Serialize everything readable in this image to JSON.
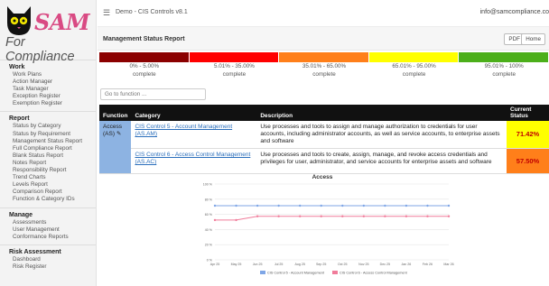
{
  "logo": {
    "sam": "SAM",
    "tagline": "For Compliance"
  },
  "topbar": {
    "menu_icon": "hamburger-icon",
    "breadcrumb": "Demo - CIS Controls v8.1",
    "user": "info@samcompliance.co"
  },
  "sidebar": {
    "sections": [
      {
        "heading": "Work",
        "items": [
          "Work Plans",
          "Action Manager",
          "Task Manager",
          "Exception Register",
          "Exemption Register"
        ]
      },
      {
        "heading": "Report",
        "items": [
          "Status by Category",
          "Status by Requirement",
          "Management Status Report",
          "Full Compliance Report",
          "Blank Status Report",
          "Notes Report",
          "Responsibility Report",
          "Trend Charts",
          "Levels Report",
          "Comparison Report",
          "Function & Category IDs"
        ]
      },
      {
        "heading": "Manage",
        "items": [
          "Assessments",
          "User Management",
          "Conformance Reports"
        ]
      },
      {
        "heading": "Risk Assessment",
        "items": [
          "Dashboard",
          "Risk Register"
        ]
      }
    ]
  },
  "report": {
    "title": "Management Status Report",
    "pdf_label": "PDF",
    "home_label": "Home"
  },
  "legend": [
    {
      "range": "0% - 5.00%",
      "label": "complete",
      "color": "#8b0000"
    },
    {
      "range": "5.01% - 35.00%",
      "label": "complete",
      "color": "#ff0000"
    },
    {
      "range": "35.01% - 65.00%",
      "label": "complete",
      "color": "#ff7f1a"
    },
    {
      "range": "65.01% - 95.00%",
      "label": "complete",
      "color": "#ffff00"
    },
    {
      "range": "95.01% - 100%",
      "label": "complete",
      "color": "#4caf1a"
    }
  ],
  "goto": {
    "placeholder": "Go to function ..."
  },
  "table": {
    "headers": {
      "function": "Function",
      "category": "Category",
      "description": "Description",
      "status": "Current Status"
    },
    "function_label": "Access (AS)",
    "function_icon": "edit-icon",
    "rows": [
      {
        "category": "CIS Control 5 - Account Management (AS.AM)",
        "description": "Use processes and tools to assign and manage authorization to credentials for user accounts, including administrator accounts, as well as service accounts, to enterprise assets and software",
        "status": "71.42%"
      },
      {
        "category": "CIS Control 6 - Access Control Management (AS.AC)",
        "description": "Use processes and tools to create, assign, manage, and revoke access credentials and privileges for user, administrator, and service accounts for enterprise assets and software",
        "status": "57.50%"
      }
    ]
  },
  "chart_data": {
    "type": "line",
    "title": "Access",
    "categories": [
      "Apr 25",
      "May 25",
      "Jun 25",
      "Jul 25",
      "Aug 25",
      "Sep 25",
      "Oct 25",
      "Nov 25",
      "Dec 25",
      "Jan 26",
      "Feb 26",
      "Mar 26"
    ],
    "ylim": [
      0,
      100
    ],
    "yticks": [
      "0 %",
      "20 %",
      "40 %",
      "60 %",
      "80 %",
      "100 %"
    ],
    "grid": true,
    "legend_position": "bottom",
    "series": [
      {
        "name": "CIS Control 5 - Account Management",
        "color": "#7fa6e6",
        "values": [
          71.42,
          71.42,
          71.42,
          71.42,
          71.42,
          71.42,
          71.42,
          71.42,
          71.42,
          71.42,
          71.42,
          71.42
        ]
      },
      {
        "name": "CIS Control 6 - Access Control Management",
        "color": "#f07c9a",
        "values": [
          52.5,
          52.5,
          57.5,
          57.5,
          57.5,
          57.5,
          57.5,
          57.5,
          57.5,
          57.5,
          57.5,
          57.5
        ]
      }
    ]
  }
}
